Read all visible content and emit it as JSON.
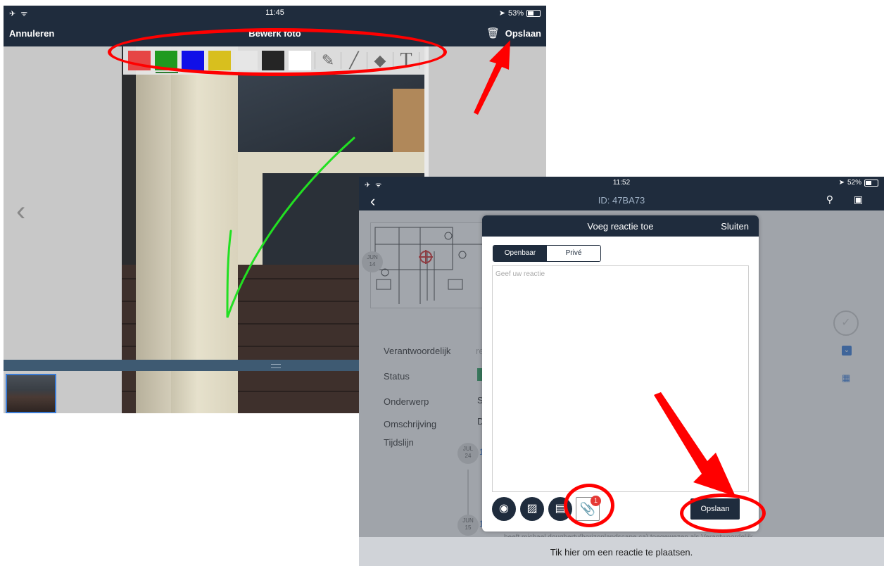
{
  "screen1": {
    "status": {
      "left": "✈ ᯤ",
      "time": "11:45",
      "battery": "53%",
      "battery_level": 0.53
    },
    "nav": {
      "cancel": "Annuleren",
      "title": "Bewerk foto",
      "save": "Opslaan",
      "trash_icon": "trash-icon"
    },
    "colors": [
      "#e64545",
      "#1f9a1f",
      "#1010e8",
      "#d8bf1e",
      "#e6e6e6",
      "#252525",
      "#ffffff"
    ],
    "selected_color_index": 1,
    "tools": [
      "pencil-icon",
      "brush-icon",
      "eraser-icon",
      "text-icon"
    ],
    "tool_text_glyph": "T",
    "back_chevron": "‹",
    "strip_handle": "≡"
  },
  "screen2": {
    "status": {
      "left": "✈ ᯤ",
      "time": "11:52",
      "battery": "52%",
      "battery_level": 0.52
    },
    "nav": {
      "back": "‹",
      "title": "ID: 47BA73"
    },
    "timeline_top": {
      "month": "JUN",
      "day": "14"
    },
    "fields": [
      {
        "label": "Verantwoordelijk",
        "value": "re"
      },
      {
        "label": "Status",
        "value": ""
      },
      {
        "label": "Onderwerp",
        "value": "S"
      },
      {
        "label": "Omschrijving",
        "value": "D"
      },
      {
        "label": "Tijdslijn",
        "value": ""
      }
    ],
    "timeline": [
      {
        "month": "JUL",
        "day": "24",
        "text": "1"
      },
      {
        "month": "JUN",
        "day": "15",
        "text": "1"
      }
    ],
    "timeline_partial_text": "heeft michael dougherty(horizonlandscape.ca) toegewezen als Verantwoordelijk",
    "bottom_bar": "Tik hier om een reactie te plaatsen.",
    "modal": {
      "title": "Voeg reactie toe",
      "close": "Sluiten",
      "tabs": [
        "Openbaar",
        "Privé"
      ],
      "placeholder": "Geef uw reactie",
      "attachment_count": "1",
      "save": "Opslaan"
    }
  }
}
